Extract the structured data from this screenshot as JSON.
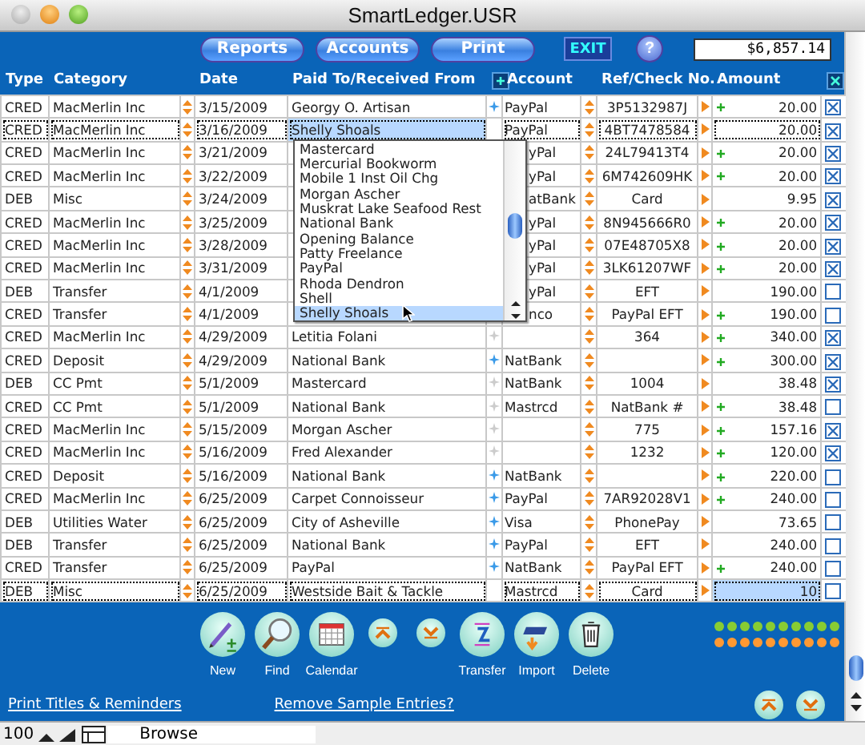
{
  "window": {
    "title": "SmartLedger.USR"
  },
  "toolbar": {
    "buttons": [
      "Reports",
      "Accounts",
      "Print"
    ],
    "exit": "EXIT",
    "help": "?",
    "balance": "$6,857.14"
  },
  "columns": [
    "Type",
    "Category",
    "Date",
    "Paid To/Received From",
    "Account",
    "Ref/Check No.",
    "Amount"
  ],
  "rows": [
    {
      "type": "CRED",
      "category": "MacMerlin Inc",
      "date": "3/15/2009",
      "payee": "Georgy O. Artisan",
      "starred": true,
      "covered": false,
      "account": "PayPal",
      "ref": "3P5132987J",
      "plus": true,
      "amount": "20.00",
      "checked": true,
      "focused": false
    },
    {
      "type": "CRED",
      "category": "MacMerlin Inc",
      "date": "3/16/2009",
      "payee": "Shelly Shoals",
      "covered": false,
      "account": "PayPal",
      "ref": "4BT7478584",
      "plus": false,
      "amount": "20.00",
      "checked": true,
      "focused": true,
      "payee_active": true,
      "amount_active": false
    },
    {
      "type": "CRED",
      "category": "MacMerlin Inc",
      "date": "3/21/2009",
      "covered": true,
      "account": "yPal",
      "ref": "24L79413T4",
      "plus": true,
      "amount": "20.00",
      "checked": true,
      "focused": false
    },
    {
      "type": "CRED",
      "category": "MacMerlin Inc",
      "date": "3/22/2009",
      "covered": true,
      "account": "yPal",
      "ref": "6M742609HK",
      "plus": true,
      "amount": "20.00",
      "checked": true,
      "focused": false
    },
    {
      "type": "DEB",
      "category": "Misc",
      "date": "3/24/2009",
      "covered": true,
      "account": "atBank",
      "ref": "Card",
      "plus": false,
      "amount": "9.95",
      "checked": true,
      "focused": false
    },
    {
      "type": "CRED",
      "category": "MacMerlin Inc",
      "date": "3/25/2009",
      "covered": true,
      "account": "yPal",
      "ref": "8N945666R0",
      "plus": true,
      "amount": "20.00",
      "checked": true,
      "focused": false
    },
    {
      "type": "CRED",
      "category": "MacMerlin Inc",
      "date": "3/28/2009",
      "covered": true,
      "account": "yPal",
      "ref": "07E48705X8",
      "plus": true,
      "amount": "20.00",
      "checked": true,
      "focused": false
    },
    {
      "type": "CRED",
      "category": "MacMerlin Inc",
      "date": "3/31/2009",
      "covered": true,
      "account": "yPal",
      "ref": "3LK61207WF",
      "plus": true,
      "amount": "20.00",
      "checked": true,
      "focused": false
    },
    {
      "type": "DEB",
      "category": "Transfer",
      "date": "4/1/2009",
      "covered": true,
      "account": "yPal",
      "ref": "EFT",
      "plus": false,
      "amount": "190.00",
      "checked": false,
      "focused": false
    },
    {
      "type": "CRED",
      "category": "Transfer",
      "date": "4/1/2009",
      "covered": true,
      "account": "nco",
      "ref": "PayPal EFT",
      "plus": true,
      "amount": "190.00",
      "checked": false,
      "focused": false
    },
    {
      "type": "CRED",
      "category": "MacMerlin Inc",
      "date": "4/29/2009",
      "payee": "Letitia Folani",
      "starred": false,
      "covered": false,
      "ref": "364",
      "plus": true,
      "amount": "340.00",
      "checked": true,
      "focused": false
    },
    {
      "type": "CRED",
      "category": "Deposit",
      "date": "4/29/2009",
      "payee": "National Bank",
      "starred": true,
      "covered": false,
      "account": "NatBank",
      "plus": true,
      "amount": "300.00",
      "checked": true,
      "focused": false
    },
    {
      "type": "DEB",
      "category": "CC Pmt",
      "date": "5/1/2009",
      "payee": "Mastercard",
      "starred": false,
      "covered": false,
      "account": "NatBank",
      "ref": "1004",
      "plus": false,
      "amount": "38.48",
      "checked": true,
      "focused": false
    },
    {
      "type": "CRED",
      "category": "CC Pmt",
      "date": "5/1/2009",
      "payee": "National Bank",
      "starred": false,
      "covered": false,
      "account": "Mastrcd",
      "ref": "NatBank #",
      "plus": true,
      "amount": "38.48",
      "checked": false,
      "focused": false
    },
    {
      "type": "CRED",
      "category": "MacMerlin Inc",
      "date": "5/15/2009",
      "payee": "Morgan Ascher",
      "starred": false,
      "covered": false,
      "ref": "775",
      "plus": true,
      "amount": "157.16",
      "checked": true,
      "focused": false
    },
    {
      "type": "CRED",
      "category": "MacMerlin Inc",
      "date": "5/16/2009",
      "payee": "Fred Alexander",
      "starred": false,
      "covered": false,
      "ref": "1232",
      "plus": true,
      "amount": "120.00",
      "checked": true,
      "focused": false
    },
    {
      "type": "CRED",
      "category": "Deposit",
      "date": "5/16/2009",
      "payee": "National Bank",
      "starred": true,
      "covered": false,
      "account": "NatBank",
      "plus": true,
      "amount": "220.00",
      "checked": false,
      "focused": false
    },
    {
      "type": "CRED",
      "category": "MacMerlin Inc",
      "date": "6/25/2009",
      "payee": "Carpet Connoisseur",
      "starred": true,
      "covered": false,
      "account": "PayPal",
      "ref": "7AR92028V1",
      "plus": true,
      "amount": "240.00",
      "checked": false,
      "focused": false
    },
    {
      "type": "DEB",
      "category": "Utilities Water",
      "date": "6/25/2009",
      "payee": "City of Asheville",
      "starred": true,
      "covered": false,
      "account": "Visa",
      "ref": "PhonePay",
      "plus": false,
      "amount": "73.65",
      "checked": false,
      "focused": false
    },
    {
      "type": "DEB",
      "category": "Transfer",
      "date": "6/25/2009",
      "payee": "National Bank",
      "starred": true,
      "covered": false,
      "account": "PayPal",
      "ref": "EFT",
      "plus": false,
      "amount": "240.00",
      "checked": false,
      "focused": false
    },
    {
      "type": "CRED",
      "category": "Transfer",
      "date": "6/25/2009",
      "payee": "PayPal",
      "starred": true,
      "covered": false,
      "account": "NatBank",
      "ref": "PayPal EFT",
      "plus": true,
      "amount": "240.00",
      "checked": false,
      "focused": false
    },
    {
      "type": "DEB",
      "category": "Misc",
      "date": "6/25/2009",
      "payee": "Westside Bait & Tackle",
      "covered": false,
      "account": "Mastrcd",
      "ref": "Card",
      "plus": false,
      "amount": "10",
      "checked": false,
      "focused": true,
      "payee_active": false,
      "amount_active": true
    }
  ],
  "dropdown": {
    "items": [
      {
        "label": "Mastercard",
        "selected": false
      },
      {
        "label": "Mercurial Bookworm",
        "selected": false
      },
      {
        "label": "Mobile 1 Inst Oil Chg",
        "selected": false
      },
      {
        "label": "Morgan Ascher",
        "selected": false
      },
      {
        "label": "Muskrat Lake Seafood Rest",
        "selected": false
      },
      {
        "label": "National Bank",
        "selected": false
      },
      {
        "label": "Opening Balance",
        "selected": false
      },
      {
        "label": "Patty Freelance",
        "selected": false
      },
      {
        "label": "PayPal",
        "selected": false
      },
      {
        "label": "Rhoda Dendron",
        "selected": false
      },
      {
        "label": "Shell",
        "selected": false
      },
      {
        "label": "Shelly Shoals",
        "selected": true
      }
    ]
  },
  "actions": [
    {
      "kind": "new",
      "label": "New"
    },
    {
      "kind": "find",
      "label": "Find"
    },
    {
      "kind": "calendar",
      "label": "Calendar"
    },
    {
      "kind": "up"
    },
    {
      "kind": "down"
    },
    {
      "kind": "transfer",
      "label": "Transfer"
    },
    {
      "kind": "import",
      "label": "Import"
    },
    {
      "kind": "delete",
      "label": "Delete"
    }
  ],
  "links": [
    "Print Titles & Reminders",
    "Remove Sample Entries?"
  ],
  "status_bar": {
    "zoom": "100",
    "mode": "Browse"
  }
}
